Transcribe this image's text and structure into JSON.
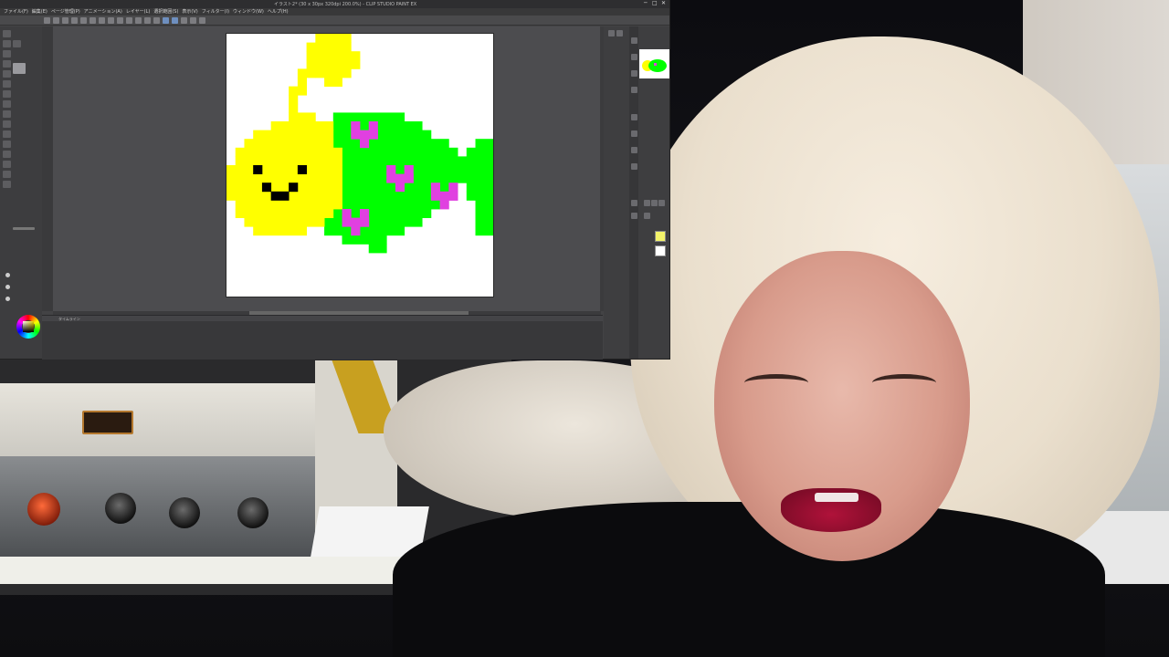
{
  "window": {
    "title": "イラスト2* (30 x 30px 320dpi 200.0%) - CLIP STUDIO PAINT EX",
    "controls": [
      "─",
      "□",
      "✕"
    ]
  },
  "menu": {
    "items": [
      "ファイル(F)",
      "編集(E)",
      "ページ管理(P)",
      "アニメーション(A)",
      "レイヤー(L)",
      "選択範囲(S)",
      "表示(V)",
      "フィルター(I)",
      "ウィンドウ(W)",
      "ヘルプ(H)"
    ]
  },
  "timeline": {
    "label": "タイムライン"
  },
  "colors": {
    "yellow": "#ffff00",
    "green": "#00ff00",
    "magenta": "#e040e0",
    "black": "#000000",
    "paper": "#ffffff",
    "ui_dark": "#434345"
  },
  "icons": {
    "title": "app-titlebar",
    "wheel": "color-wheel-icon",
    "navigator": "navigator-thumbnail"
  }
}
